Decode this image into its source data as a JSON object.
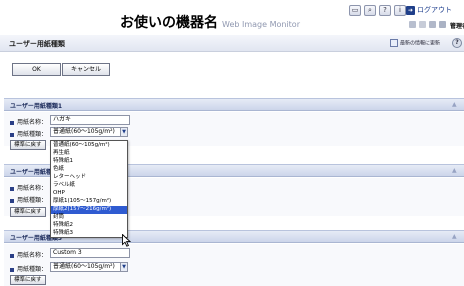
{
  "header": {
    "device_name": "お使いの機器名",
    "subtitle": "Web Image Monitor",
    "logout": "ログアウト",
    "admin": "管理者",
    "icons": [
      "monitor-icon",
      "search-icon",
      "help-icon",
      "info-icon"
    ]
  },
  "page": {
    "title": "ユーザー用紙種類",
    "refresh": "最新の情報に更新",
    "ok": "OK",
    "cancel": "キャンセル"
  },
  "labels": {
    "paper_name": "用紙名称：",
    "paper_type": "用紙種類：",
    "reset": "標準に戻す"
  },
  "sections": [
    {
      "title": "ユーザー用紙種類1",
      "name_value": "ハガキ",
      "type_value": "普通紙(60～105g/m²)"
    },
    {
      "title": "ユーザー用紙種類2"
    },
    {
      "title": "ユーザー用紙種類3",
      "name_value": "Custom 3",
      "type_value": "普通紙(60～105g/m²)"
    }
  ],
  "dropdown": {
    "options": [
      "普通紙(60～105g/m²)",
      "再生紙",
      "特殊紙1",
      "色紙",
      "レターヘッド",
      "ラベル紙",
      "OHP",
      "厚紙1(105～157g/m²)",
      "厚紙2(157～216g/m²)",
      "封筒",
      "特殊紙2",
      "特殊紙3"
    ],
    "selected_index": 8
  },
  "colors": {
    "accent": "#1f3f8a",
    "selection": "#2f5bd1",
    "section_bar": "#d6ddef"
  }
}
